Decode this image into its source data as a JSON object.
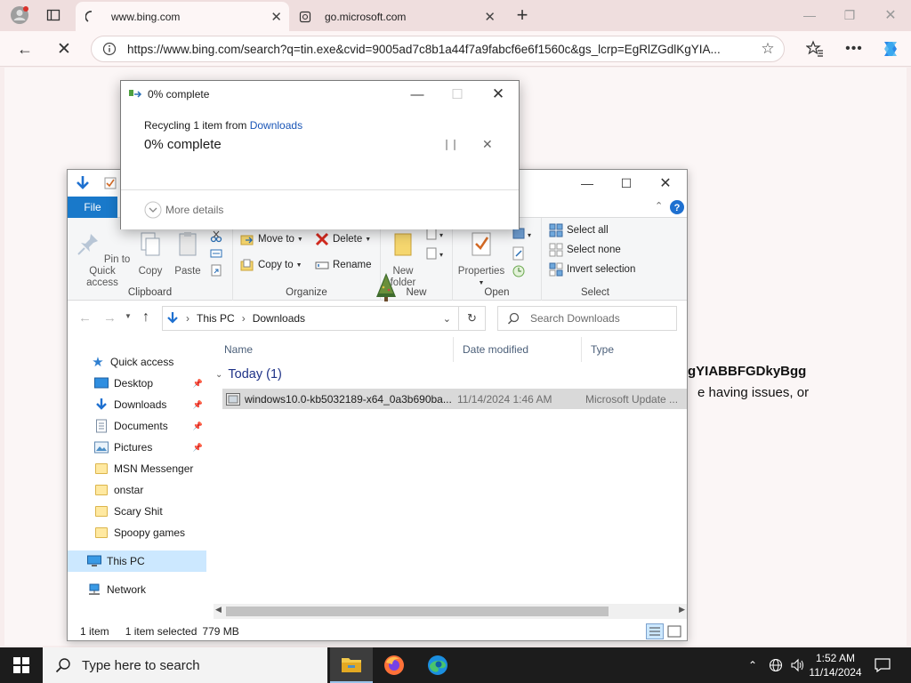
{
  "browser": {
    "tabs": [
      {
        "title": "www.bing.com"
      },
      {
        "title": "go.microsoft.com"
      }
    ],
    "url": "https://www.bing.com/search?q=tin.exe&cvid=9005ad7c8b1a44f7a9fabcf6e6f1560c&gs_lcrp=EgRlZGdlKgYIA...",
    "page_fragments": [
      "gYIABBFGDkyBgg",
      "e having issues, or"
    ]
  },
  "progress_dialog": {
    "title": "0% complete",
    "status_prefix": "Recycling 1 item from ",
    "status_link": "Downloads",
    "percent_text": "0% complete",
    "percent": 0,
    "more_details": "More details"
  },
  "explorer": {
    "file_tab": "File",
    "ribbon": {
      "clipboard": {
        "caption": "Clipboard",
        "pin": "Pin to Quick access",
        "copy": "Copy",
        "paste": "Paste"
      },
      "organize": {
        "caption": "Organize",
        "move_to": "Move to",
        "copy_to": "Copy to",
        "delete": "Delete",
        "rename": "Rename"
      },
      "new": {
        "caption": "New",
        "new_folder": "New folder"
      },
      "open": {
        "caption": "Open",
        "properties": "Properties"
      },
      "select": {
        "caption": "Select",
        "select_all": "Select all",
        "select_none": "Select none",
        "invert": "Invert selection"
      }
    },
    "breadcrumb": [
      "This PC",
      "Downloads"
    ],
    "search_placeholder": "Search Downloads",
    "columns": [
      "Name",
      "Date modified",
      "Type"
    ],
    "group": "Today (1)",
    "files": [
      {
        "name": "windows10.0-kb5032189-x64_0a3b690ba...",
        "date": "11/14/2024 1:46 AM",
        "type": "Microsoft Update ..."
      }
    ],
    "nav": {
      "quick_access": "Quick access",
      "items": [
        {
          "label": "Desktop",
          "pinned": true
        },
        {
          "label": "Downloads",
          "pinned": true
        },
        {
          "label": "Documents",
          "pinned": true
        },
        {
          "label": "Pictures",
          "pinned": true
        },
        {
          "label": "MSN Messenger"
        },
        {
          "label": "onstar"
        },
        {
          "label": "Scary Shit"
        },
        {
          "label": "Spoopy games"
        }
      ],
      "this_pc": "This PC",
      "network": "Network"
    },
    "status": {
      "count": "1 item",
      "selected": "1 item selected",
      "size": "779 MB"
    }
  },
  "taskbar": {
    "search_placeholder": "Type here to search",
    "time": "1:52 AM",
    "date": "11/14/2024"
  },
  "colors": {
    "accent": "#1979ca",
    "selection": "#cce8ff",
    "link": "#1a56b7"
  }
}
